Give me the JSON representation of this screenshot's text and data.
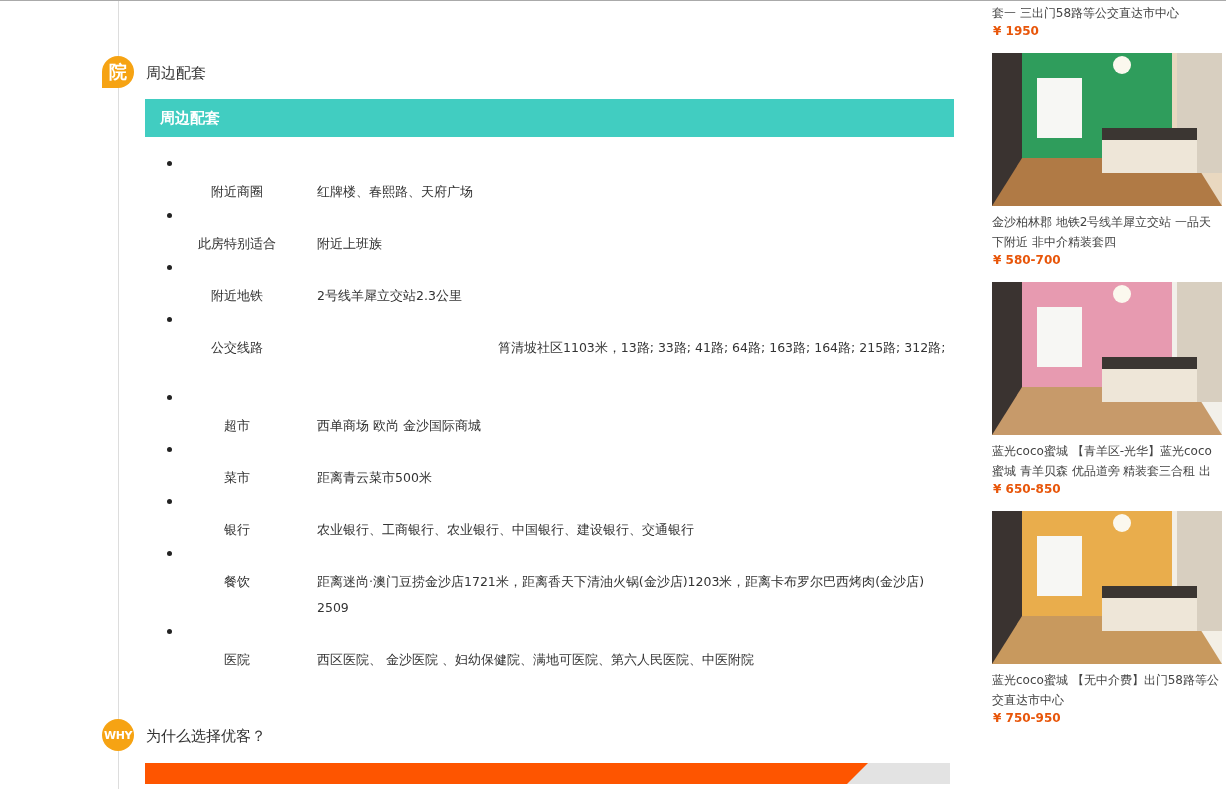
{
  "nearby": {
    "badge": "院",
    "heading": "周边配套",
    "bar_title": "周边配套",
    "items": [
      {
        "kind": "plain",
        "label": "附近商圈",
        "value": "红牌楼、春熙路、天府广场"
      },
      {
        "kind": "plain",
        "label": "此房特别适合",
        "value": "附近上班族"
      },
      {
        "kind": "plain",
        "label": "附近地铁",
        "value": "2号线羊犀立交站2.3公里"
      },
      {
        "kind": "offset",
        "label": "公交线路",
        "value": "筲清坡社区1103米，13路; 33路; 41路; 64路; 163路; 164路; 215路; 312路;"
      },
      {
        "kind": "plain",
        "label": "超市",
        "value": "西单商场 欧尚 金沙国际商城"
      },
      {
        "kind": "plain",
        "label": "菜市",
        "value": "距离青云菜市500米"
      },
      {
        "kind": "plain",
        "label": "银行",
        "value": "农业银行、工商银行、农业银行、中国银行、建设银行、交通银行"
      },
      {
        "kind": "plain",
        "label": "餐饮",
        "value": "距离迷尚·澳门豆捞金沙店1721米，距离香天下清油火锅(金沙店)1203米，距离卡布罗尔巴西烤肉(金沙店) 2509"
      },
      {
        "kind": "plain",
        "label": "医院",
        "value": "西区医院、 金沙医院 、妇幼保健院、满地可医院、第六人民医院、中医附院"
      }
    ]
  },
  "why": {
    "badge": "WHY",
    "heading": "为什么选择优客？"
  },
  "sidebar": {
    "cards": [
      {
        "has_picture": false,
        "title": "套一 三出门58路等公交直达市中心",
        "price": "¥ 1950"
      },
      {
        "has_picture": true,
        "title": "金沙柏林郡 地铁2号线羊犀立交站 一品天下附近 非中介精装套四",
        "price": "¥ 580-700"
      },
      {
        "has_picture": true,
        "title": "蓝光coco蜜城 【青羊区-光华】蓝光coco蜜城 青羊贝森 优品道旁 精装套三合租 出",
        "price": "¥ 650-850"
      },
      {
        "has_picture": true,
        "title": "蓝光coco蜜城 【无中介费】出门58路等公交直达市中心",
        "price": "¥ 750-950"
      }
    ]
  }
}
